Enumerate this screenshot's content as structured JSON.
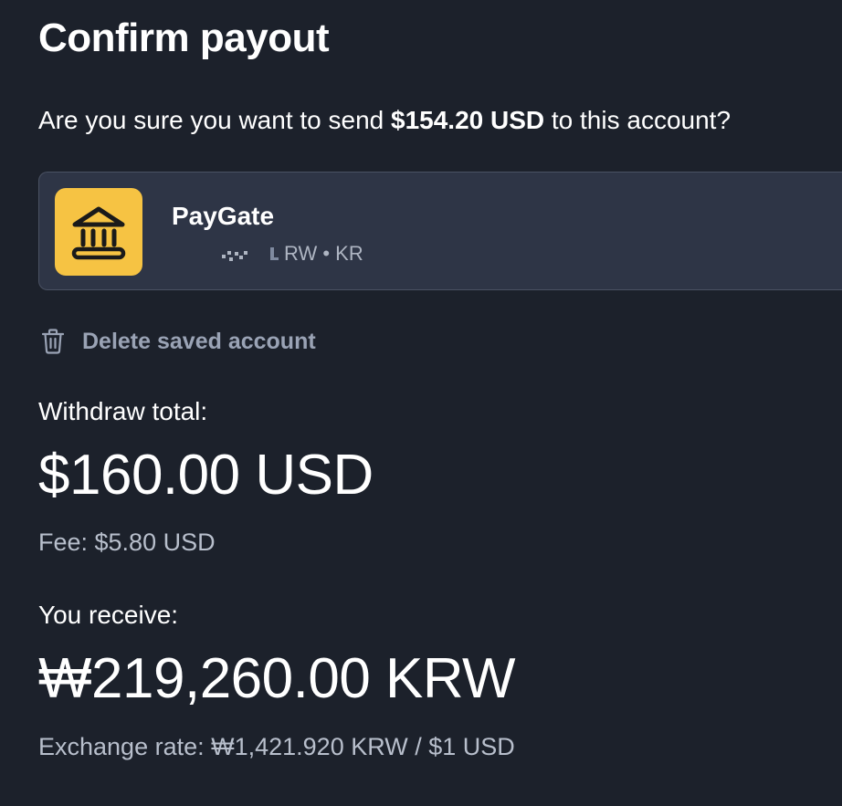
{
  "title": "Confirm payout",
  "confirm_question": {
    "prefix": "Are you sure you want to send ",
    "amount": "$154.20 USD",
    "suffix": " to this account?"
  },
  "account": {
    "name": "PayGate",
    "detail": "RW • KR",
    "icon": "bank-icon",
    "icon_bg": "#f6c343"
  },
  "delete_action": {
    "label": "Delete saved account",
    "icon": "trash-icon"
  },
  "withdraw": {
    "label": "Withdraw total:",
    "amount": "$160.00 USD",
    "fee": "Fee: $5.80 USD"
  },
  "receive": {
    "label": "You receive:",
    "amount": "₩219,260.00 KRW",
    "exchange_rate": "Exchange rate: ₩1,421.920 KRW / $1 USD"
  },
  "colors": {
    "background": "#1c212b",
    "card": "#2e3546",
    "muted_text": "#9aa3b5"
  }
}
